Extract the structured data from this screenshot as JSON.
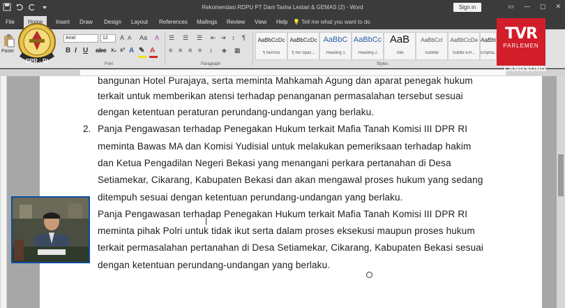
{
  "window": {
    "title": "Rekomendasi RDPU PT Dani Tasha Lestari & GEMAS (2) - Word",
    "sign_in": "Sign in"
  },
  "tabs": [
    {
      "label": "File"
    },
    {
      "label": "Home"
    },
    {
      "label": "Insert"
    },
    {
      "label": "Draw"
    },
    {
      "label": "Design"
    },
    {
      "label": "Layout"
    },
    {
      "label": "References"
    },
    {
      "label": "Mailings"
    },
    {
      "label": "Review"
    },
    {
      "label": "View"
    },
    {
      "label": "Help"
    }
  ],
  "tell_me": "Tell me what you want to do",
  "ribbon": {
    "paste_label": "Paste",
    "font_name": "Arial",
    "font_size": "12",
    "font_group_label": "Font",
    "paragraph_group_label": "Paragraph",
    "styles_group_label": "Styles",
    "styles": [
      {
        "preview": "AaBbCcDc",
        "name": "¶ Normal"
      },
      {
        "preview": "AaBbCcDc",
        "name": "¶ No Spac..."
      },
      {
        "preview": "AaBbC",
        "name": "Heading 1"
      },
      {
        "preview": "AaBbCc",
        "name": "Heading 2"
      },
      {
        "preview": "AaB",
        "name": "Title"
      },
      {
        "preview": "AaBbCcI",
        "name": "Subtitle"
      },
      {
        "preview": "AaBbCcDa",
        "name": "Subtle Em..."
      },
      {
        "preview": "AaBbCcDa",
        "name": "Empha..."
      }
    ]
  },
  "document": {
    "lines": [
      "bangunan Hotel Purajaya, serta meminta Mahkamah Agung dan aparat penegak hukum",
      "terkait untuk memberikan atensi terhadap penanganan permasalahan tersebut sesuai",
      "dengan ketentuan peraturan perundang-undangan yang berlaku.",
      "Panja Pengawasan terhadap Penegakan Hukum terkait Mafia Tanah Komisi III DPR RI",
      "meminta Bawas MA dan Komisi Yudisial untuk melakukan pemeriksaan terhadap hakim",
      "dan Ketua Pengadilan Negeri Bekasi yang menangani perkara pertanahan di Desa",
      "Setiamekar, Cikarang, Kabupaten Bekasi dan akan mengawal proses hukum yang sedang",
      "ditempuh sesuai dengan ketentuan perundang-undangan yang berlaku.",
      "Panja Pengawasan terhadap Penegakan Hukum terkait Mafia Tanah Komisi III DPR RI",
      "meminta pihak Polri untuk tidak ikut serta dalam proses eksekusi maupun proses hukum",
      "terkait permasalahan pertanahan di Desa Setiamekar, Cikarang, Kabupaten Bekasi sesuai",
      "dengan ketentuan perundang-undangan yang berlaku."
    ],
    "item_number": "2."
  },
  "overlay": {
    "logo_text": "DPR - RI",
    "channel_big": "TVR",
    "channel_small": "PARLEMEN",
    "live_label": "LANGSUNG"
  },
  "colors": {
    "channel_red": "#d11e2a",
    "word_dark": "#3b3b3b",
    "webcam_frame": "#0a4ea0"
  }
}
